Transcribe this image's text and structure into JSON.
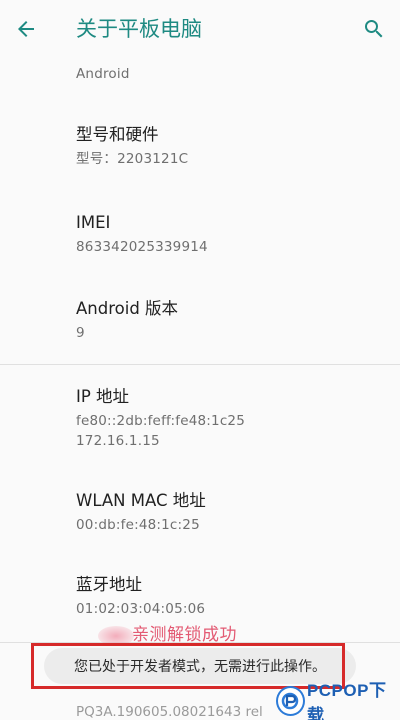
{
  "appbar": {
    "title": "关于平板电脑",
    "back_icon": "arrow-left-icon",
    "search_icon": "search-icon",
    "accent_color": "#1e8a82"
  },
  "items": [
    {
      "title": "",
      "summary": "Android"
    },
    {
      "title": "型号和硬件",
      "summary": "型号：2203121C"
    },
    {
      "title": "IMEI",
      "summary": "863342025339914"
    },
    {
      "title": "Android 版本",
      "summary": "9"
    },
    {
      "title": "IP 地址",
      "summary_lines": [
        "fe80::2db:feff:fe48:1c25",
        "172.16.1.15"
      ]
    },
    {
      "title": "WLAN MAC 地址",
      "summary": "00:db:fe:48:1c:25"
    },
    {
      "title": "蓝牙地址",
      "summary": "01:02:03:04:05:06"
    }
  ],
  "partially_hidden_row": "PQ3A.190605.08021643 rel",
  "overlay": {
    "watermark": "亲测解锁成功",
    "toast": "您已处于开发者模式，无需进行此操作。",
    "highlight_color": "#d62a2a"
  },
  "logo": {
    "text": "PCPOP下载",
    "icon": "pcpop-logo-icon"
  }
}
